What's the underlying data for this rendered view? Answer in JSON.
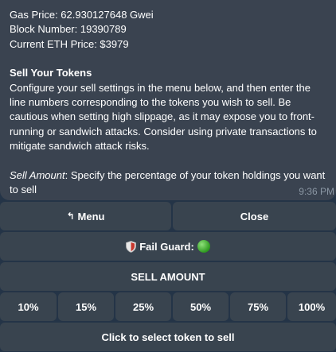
{
  "message": {
    "gas_price": "Gas Price: 62.930127648 Gwei",
    "block_number": "Block Number: 19390789",
    "eth_price": "Current ETH Price: $3979",
    "sell_heading": "Sell Your Tokens",
    "sell_description": "Configure your sell settings in the menu below, and then enter the line numbers corresponding to the tokens you wish to sell. Be cautious when setting high slippage, as it may expose you to front-running or sandwich attacks. Consider using private transactions to mitigate sandwich attack risks.",
    "sell_amount_label": "Sell Amount",
    "sell_amount_text": ": Specify the percentage of your token holdings you want to sell",
    "timestamp": "9:36 PM"
  },
  "keyboard": {
    "menu_label": "Menu",
    "menu_icon": "↰",
    "close_label": "Close",
    "fail_guard_label": "Fail Guard:",
    "fail_guard_icon": "shield-icon",
    "fail_guard_status_color": "#2e9a1f",
    "sell_amount_header": "SELL AMOUNT",
    "percentages": [
      "10%",
      "15%",
      "25%",
      "50%",
      "75%",
      "100%"
    ],
    "select_token_label": "Click to select token to sell"
  }
}
